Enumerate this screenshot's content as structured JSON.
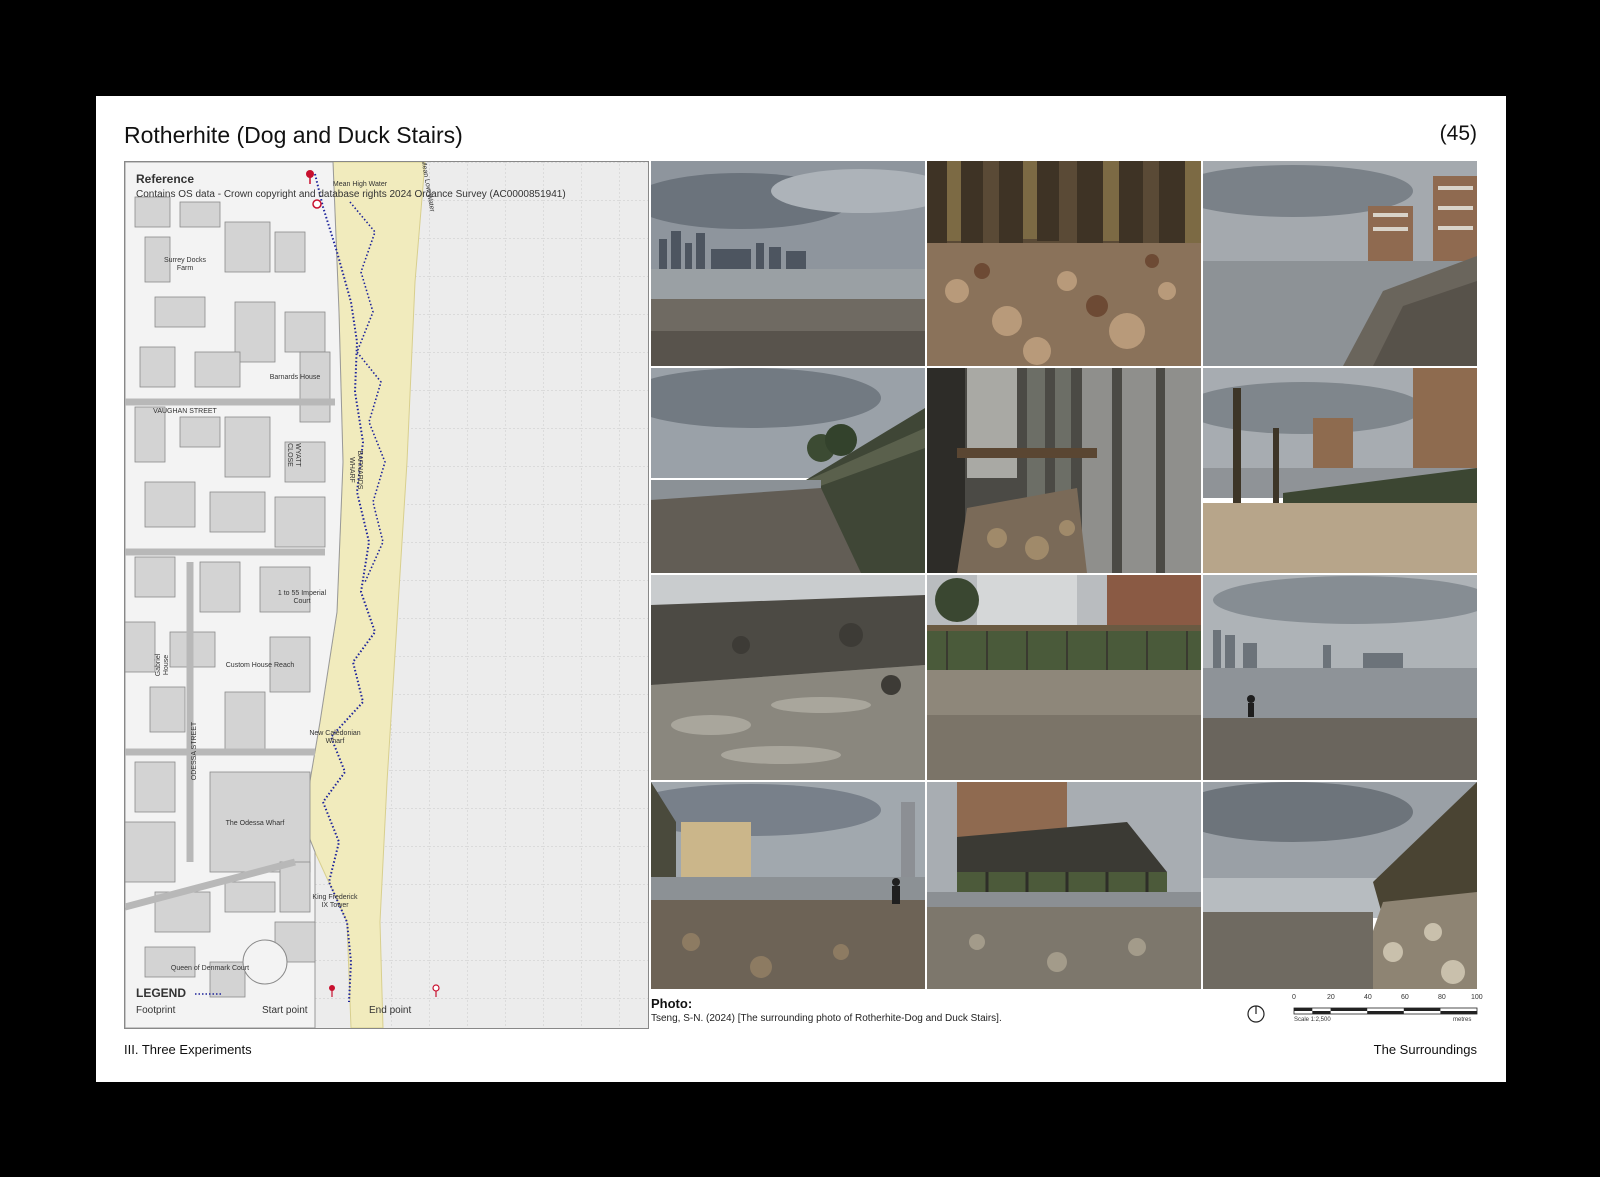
{
  "page": {
    "title": "Rotherhite (Dog and Duck Stairs)",
    "page_number": "(45)",
    "footer_left": "III. Three Experiments",
    "footer_right": "The Surroundings"
  },
  "map": {
    "reference_title": "Reference",
    "reference_text": "Contains OS data - Crown copyright and database rights 2024 Ordance Survey (AC0000851941)",
    "labels": {
      "surrey_docks_farm": "Surrey Docks Farm",
      "barnards_house": "Barnards House",
      "vaughan_street": "VAUGHAN STREET",
      "wyatt_close": "WYATT CLOSE",
      "barnards_wharf": "BARNARDS WHARF",
      "imperial_court": "1 to 55 Imperial Court",
      "custom_house_reach": "Custom House Reach",
      "gabriel_house": "Gabriel House",
      "odessa_street": "ODESSA STREET",
      "new_caledonian_wharf": "New Caledonian Wharf",
      "odessa_wharf": "The Odessa Wharf",
      "king_frederick_ix_tower": "King Frederick IX Tower",
      "queen_of_denmark_court": "Queen of Denmark Court",
      "high_water": "Mean High Water",
      "low_water": "Mean Low Water"
    },
    "legend": {
      "title": "LEGEND",
      "footprint": "Footprint",
      "start_point": "Start point",
      "end_point": "End point"
    },
    "colors": {
      "land": "#e9e9e9",
      "foreshore": "#f1ebbd",
      "footprint": "#1d239a",
      "marker": "#c8102e"
    }
  },
  "photos": [
    {
      "subject": "river-skyline"
    },
    {
      "subject": "wooden-piles-pebbles"
    },
    {
      "subject": "shore-apartments"
    },
    {
      "subject": "river-wall"
    },
    {
      "subject": "under-pier-columns"
    },
    {
      "subject": "jetty-ruins"
    },
    {
      "subject": "mudflat"
    },
    {
      "subject": "flats-behind-wall"
    },
    {
      "subject": "walker-on-shore"
    },
    {
      "subject": "shore-tower"
    },
    {
      "subject": "pier-structure"
    },
    {
      "subject": "wall-pebbles-sunlight"
    }
  ],
  "caption": {
    "title": "Photo:",
    "text": "Tseng, S-N. (2024) [The surrounding photo of Rotherhite-Dog and Duck Stairs]."
  },
  "scale": {
    "ticks": [
      "0",
      "20",
      "40",
      "60",
      "80",
      "100"
    ],
    "ratio": "Scale 1:2,500",
    "unit": "metres"
  }
}
